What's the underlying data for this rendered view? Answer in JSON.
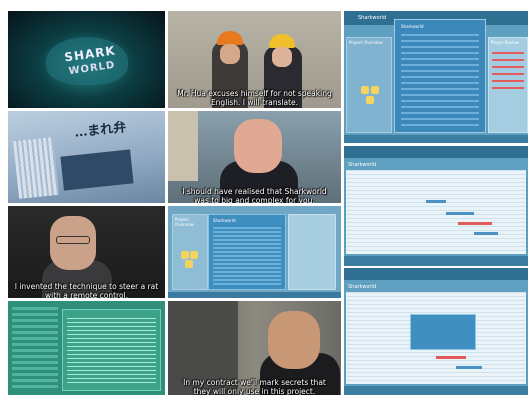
{
  "tiles": {
    "logo": {
      "line1": "SHARK",
      "line2": "WORLD"
    },
    "interview1": {
      "subtitle": "Mr. Hua excuses himself for not speaking English. I will translate."
    },
    "newspaper": {
      "headline": "…まれ弁"
    },
    "interview2": {
      "subtitle": "I should have realised that Sharkworld was to big and complex for you."
    },
    "interview3": {
      "subtitle": "I invented the technique to steer a rat with a remote control."
    },
    "app_small": {
      "panel_left": "Project Overview",
      "panel_mid": "Sharkworld"
    },
    "interview4": {
      "subtitle": "In my contract we'll mark secrets that they will only use in this project."
    }
  },
  "app_top": {
    "title": "Sharkworld",
    "left_panel": "Project Overview",
    "mid_panel": "Sharkworld",
    "right_panel": "Player Review"
  },
  "app_mid": {
    "title": "Sharkworld"
  },
  "app_bottom": {
    "title": "Sharkworld"
  }
}
